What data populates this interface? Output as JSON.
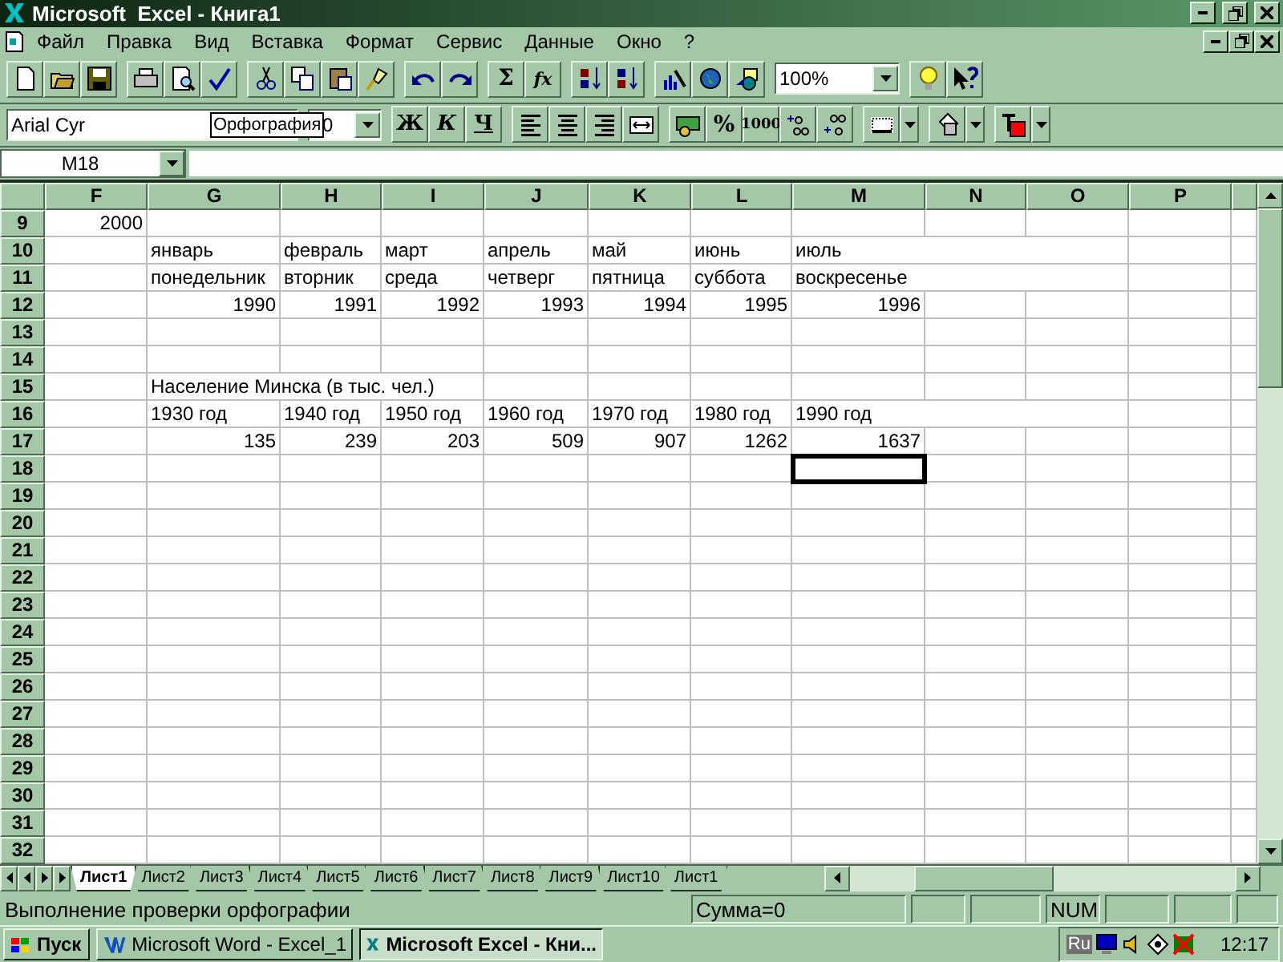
{
  "window": {
    "title": "Microsoft  Excel - Книга1"
  },
  "menu": [
    {
      "label": "Файл"
    },
    {
      "label": "Правка"
    },
    {
      "label": "Вид"
    },
    {
      "label": "Вставка"
    },
    {
      "label": "Формат"
    },
    {
      "label": "Сервис"
    },
    {
      "label": "Данные"
    },
    {
      "label": "Окно"
    },
    {
      "label": "?"
    }
  ],
  "standard_toolbar": {
    "sum": "Σ",
    "function": "fx",
    "zoom": "100%"
  },
  "formatting_toolbar": {
    "font": "Arial Cyr",
    "size": "0",
    "bold": "Ж",
    "italic": "К",
    "underline": "Ч",
    "percent": "%",
    "thousands": "1000"
  },
  "tooltip": "Орфография",
  "name_box": "M18",
  "columns": [
    "F",
    "G",
    "H",
    "I",
    "J",
    "K",
    "L",
    "M",
    "N",
    "O",
    "P"
  ],
  "rows": [
    {
      "number": "9",
      "cells": {
        "F": {
          "text": "2000",
          "kind": "number"
        }
      }
    },
    {
      "number": "10",
      "cells": {
        "G": {
          "text": "январь",
          "kind": "text"
        },
        "H": {
          "text": "февраль",
          "kind": "text"
        },
        "I": {
          "text": "март",
          "kind": "text"
        },
        "J": {
          "text": "апрель",
          "kind": "text"
        },
        "K": {
          "text": "май",
          "kind": "text"
        },
        "L": {
          "text": "июнь",
          "kind": "text"
        },
        "M": {
          "text": "июль",
          "kind": "text"
        }
      }
    },
    {
      "number": "11",
      "cells": {
        "G": {
          "text": "понедельник",
          "kind": "text"
        },
        "H": {
          "text": "вторник",
          "kind": "text"
        },
        "I": {
          "text": "среда",
          "kind": "text"
        },
        "J": {
          "text": "четверг",
          "kind": "text"
        },
        "K": {
          "text": "пятница",
          "kind": "text"
        },
        "L": {
          "text": "суббота",
          "kind": "text"
        },
        "M": {
          "text": "воскресенье",
          "kind": "text"
        }
      }
    },
    {
      "number": "12",
      "cells": {
        "G": {
          "text": "1990",
          "kind": "number"
        },
        "H": {
          "text": "1991",
          "kind": "number"
        },
        "I": {
          "text": "1992",
          "kind": "number"
        },
        "J": {
          "text": "1993",
          "kind": "number"
        },
        "K": {
          "text": "1994",
          "kind": "number"
        },
        "L": {
          "text": "1995",
          "kind": "number"
        },
        "M": {
          "text": "1996",
          "kind": "number"
        }
      }
    },
    {
      "number": "13"
    },
    {
      "number": "14"
    },
    {
      "number": "15",
      "cells": {
        "G": {
          "text": "Население Минска (в тыс. чел.)",
          "kind": "text"
        }
      }
    },
    {
      "number": "16",
      "cells": {
        "G": {
          "text": "1930 год",
          "kind": "text"
        },
        "H": {
          "text": "1940 год",
          "kind": "text"
        },
        "I": {
          "text": "1950 год",
          "kind": "text"
        },
        "J": {
          "text": "1960 год",
          "kind": "text"
        },
        "K": {
          "text": "1970 год",
          "kind": "text"
        },
        "L": {
          "text": "1980 год",
          "kind": "text"
        },
        "M": {
          "text": "1990 год",
          "kind": "text"
        }
      }
    },
    {
      "number": "17",
      "cells": {
        "G": {
          "text": "135",
          "kind": "number"
        },
        "H": {
          "text": "239",
          "kind": "number"
        },
        "I": {
          "text": "203",
          "kind": "number"
        },
        "J": {
          "text": "509",
          "kind": "number"
        },
        "K": {
          "text": "907",
          "kind": "number"
        },
        "L": {
          "text": "1262",
          "kind": "number"
        },
        "M": {
          "text": "1637",
          "kind": "number"
        }
      }
    },
    {
      "number": "18",
      "cells": {
        "M": {
          "selected": true
        }
      }
    },
    {
      "number": "19"
    },
    {
      "number": "20"
    },
    {
      "number": "21"
    },
    {
      "number": "22"
    },
    {
      "number": "23"
    },
    {
      "number": "24"
    },
    {
      "number": "25"
    },
    {
      "number": "26"
    },
    {
      "number": "27"
    },
    {
      "number": "28"
    },
    {
      "number": "29"
    },
    {
      "number": "30"
    },
    {
      "number": "31"
    },
    {
      "number": "32"
    }
  ],
  "sheet_tabs": [
    {
      "label": "Лист1",
      "selected": true
    },
    {
      "label": "Лист2",
      "selected": false
    },
    {
      "label": "Лист3",
      "selected": false
    },
    {
      "label": "Лист4",
      "selected": false
    },
    {
      "label": "Лист5",
      "selected": false
    },
    {
      "label": "Лист6",
      "selected": false
    },
    {
      "label": "Лист7",
      "selected": false
    },
    {
      "label": "Лист8",
      "selected": false
    },
    {
      "label": "Лист9",
      "selected": false
    },
    {
      "label": "Лист10",
      "selected": false
    },
    {
      "label": "Лист1",
      "selected": false
    }
  ],
  "status_bar": {
    "message": "Выполнение проверки орфографии",
    "sum": "Сумма=0",
    "num": "NUM"
  },
  "taskbar": {
    "start": "Пуск",
    "tasks": [
      {
        "label": "Microsoft Word - Excel_1",
        "selected": false,
        "kind": "word"
      },
      {
        "label": "Microsoft Excel - Кни...",
        "selected": true,
        "kind": "excel"
      }
    ],
    "language": "Ru",
    "clock": "12:17"
  }
}
